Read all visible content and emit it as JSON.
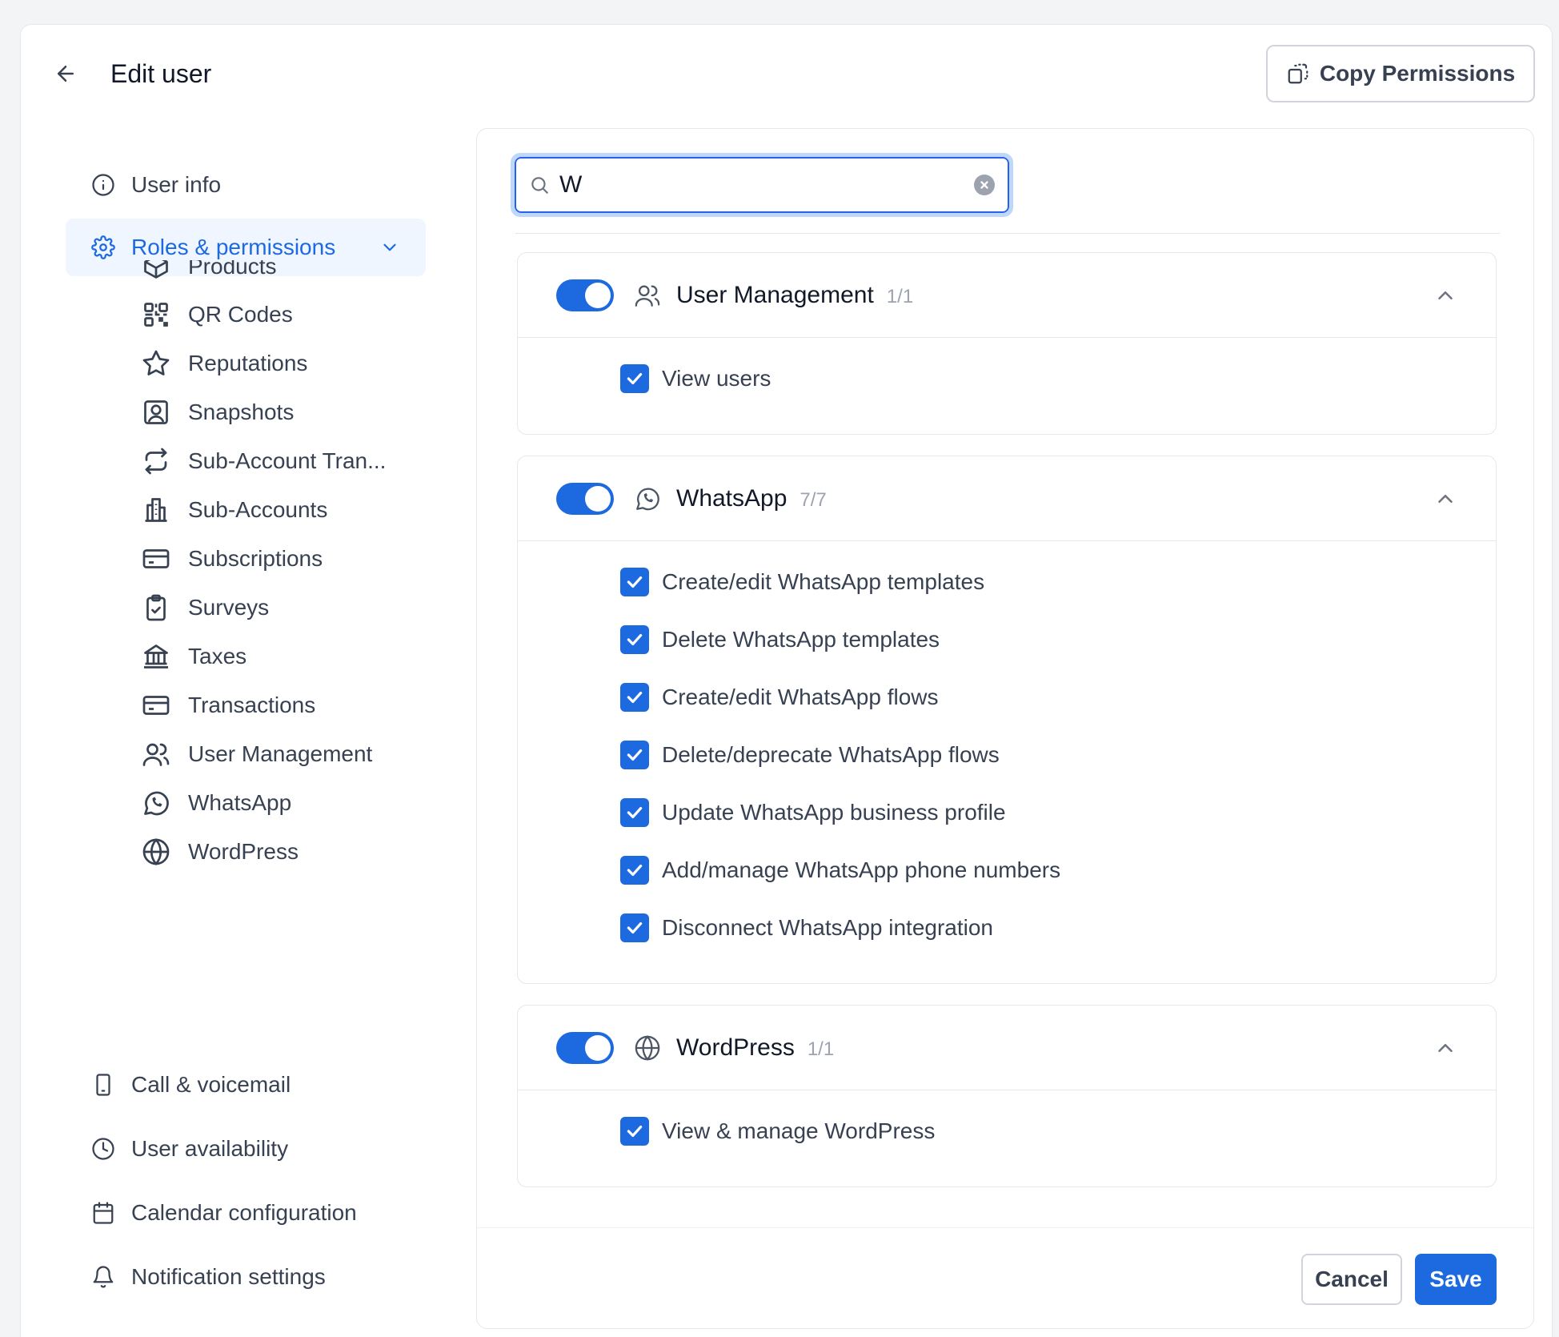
{
  "header": {
    "title": "Edit user",
    "copy_label": "Copy Permissions"
  },
  "sidebar": {
    "items": [
      {
        "label": "User info",
        "icon": "info-icon"
      },
      {
        "label": "Roles & permissions",
        "icon": "gear-icon",
        "active": true
      },
      {
        "label": "Call & voicemail",
        "icon": "phone-device-icon"
      },
      {
        "label": "User availability",
        "icon": "clock-icon"
      },
      {
        "label": "Calendar configuration",
        "icon": "calendar-icon"
      },
      {
        "label": "Notification settings",
        "icon": "bell-icon"
      }
    ],
    "sub_items": [
      {
        "label": "Products",
        "icon": "box-icon"
      },
      {
        "label": "QR Codes",
        "icon": "qr-code-icon"
      },
      {
        "label": "Reputations",
        "icon": "star-icon"
      },
      {
        "label": "Snapshots",
        "icon": "user-square-icon"
      },
      {
        "label": "Sub-Account Tran...",
        "icon": "transfer-icon"
      },
      {
        "label": "Sub-Accounts",
        "icon": "building-icon"
      },
      {
        "label": "Subscriptions",
        "icon": "credit-card-icon"
      },
      {
        "label": "Surveys",
        "icon": "clipboard-check-icon"
      },
      {
        "label": "Taxes",
        "icon": "bank-icon"
      },
      {
        "label": "Transactions",
        "icon": "credit-card-icon"
      },
      {
        "label": "User Management",
        "icon": "users-icon"
      },
      {
        "label": "WhatsApp",
        "icon": "whatsapp-icon"
      },
      {
        "label": "WordPress",
        "icon": "globe-icon"
      }
    ]
  },
  "search": {
    "value": "W",
    "placeholder": ""
  },
  "sections": [
    {
      "title": "User Management",
      "count": "1/1",
      "icon": "users-icon",
      "enabled": true,
      "permissions": [
        "View users"
      ]
    },
    {
      "title": "WhatsApp",
      "count": "7/7",
      "icon": "whatsapp-icon",
      "enabled": true,
      "permissions": [
        "Create/edit WhatsApp templates",
        "Delete WhatsApp templates",
        "Create/edit WhatsApp flows",
        "Delete/deprecate WhatsApp flows",
        "Update WhatsApp business profile",
        "Add/manage WhatsApp phone numbers",
        "Disconnect WhatsApp integration"
      ]
    },
    {
      "title": "WordPress",
      "count": "1/1",
      "icon": "globe-icon",
      "enabled": true,
      "permissions": [
        "View & manage WordPress"
      ]
    }
  ],
  "footer": {
    "cancel_label": "Cancel",
    "save_label": "Save"
  },
  "colors": {
    "accent": "#1d6ae0",
    "active_bg": "#eff6ff",
    "text": "#374151",
    "muted": "#9ca3af"
  }
}
